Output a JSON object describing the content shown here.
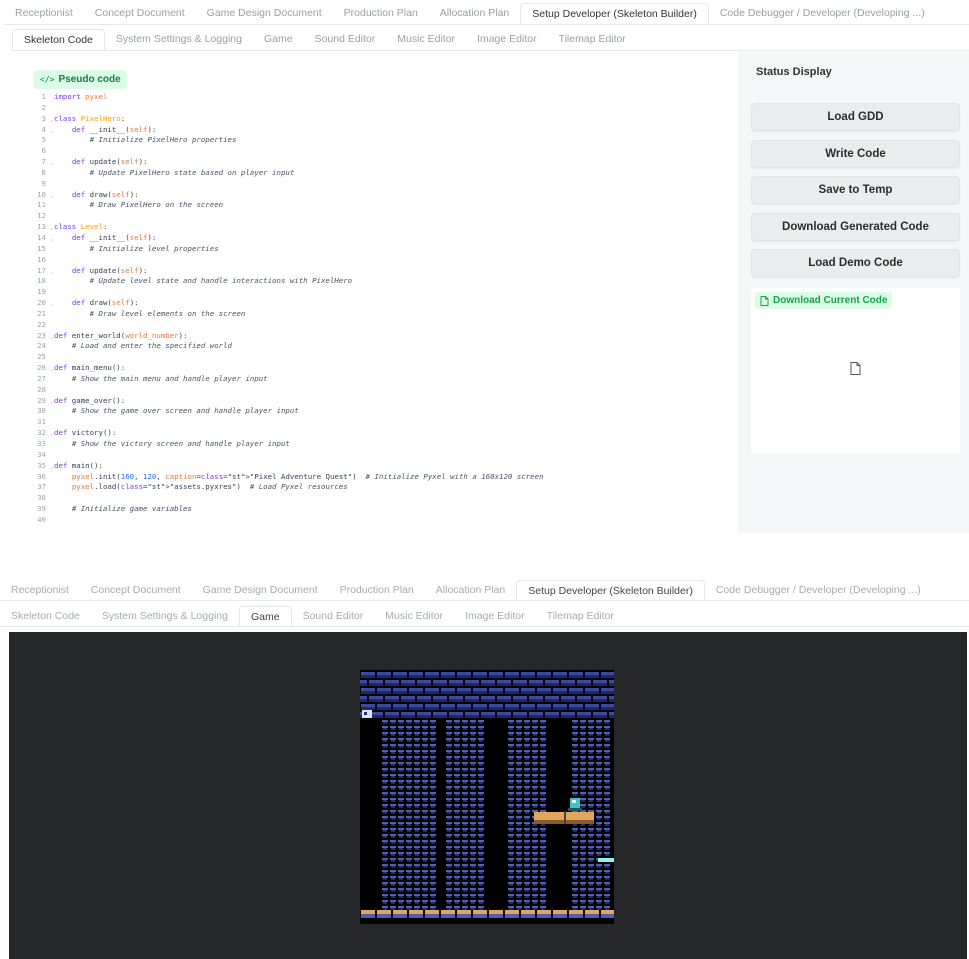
{
  "top_tabs": [
    "Receptionist",
    "Concept Document",
    "Game Design Document",
    "Production Plan",
    "Allocation Plan",
    "Setup Developer (Skeleton Builder)",
    "Code Debugger / Developer (Developing ...)"
  ],
  "top_tabs_active": 5,
  "sub_tabs": [
    "Skeleton Code",
    "System Settings & Logging",
    "Game",
    "Sound Editor",
    "Music Editor",
    "Image Editor",
    "Tilemap Editor"
  ],
  "screen1_sub_active": 0,
  "screen2_sub_active": 2,
  "code": {
    "chip_label": "Pseudo code",
    "chip_icon": "code-icon",
    "lines": [
      {
        "n": "1",
        "t": "import pyxel"
      },
      {
        "n": "2",
        "t": ""
      },
      {
        "n": "3",
        "t": "class PixelHero:",
        "fold": true
      },
      {
        "n": "4",
        "t": "    def __init__(self):",
        "fold": true
      },
      {
        "n": "5",
        "t": "        # Initialize PixelHero properties"
      },
      {
        "n": "6",
        "t": ""
      },
      {
        "n": "7",
        "t": "    def update(self):",
        "fold": true
      },
      {
        "n": "8",
        "t": "        # Update PixelHero state based on player input"
      },
      {
        "n": "9",
        "t": ""
      },
      {
        "n": "10",
        "t": "    def draw(self):",
        "fold": true
      },
      {
        "n": "11",
        "t": "        # Draw PixelHero on the screen"
      },
      {
        "n": "12",
        "t": ""
      },
      {
        "n": "13",
        "t": "class Level:",
        "fold": true
      },
      {
        "n": "14",
        "t": "    def __init__(self):",
        "fold": true
      },
      {
        "n": "15",
        "t": "        # Initialize level properties"
      },
      {
        "n": "16",
        "t": ""
      },
      {
        "n": "17",
        "t": "    def update(self):",
        "fold": true
      },
      {
        "n": "18",
        "t": "        # Update level state and handle interactions with PixelHero"
      },
      {
        "n": "19",
        "t": ""
      },
      {
        "n": "20",
        "t": "    def draw(self):",
        "fold": true
      },
      {
        "n": "21",
        "t": "        # Draw level elements on the screen"
      },
      {
        "n": "22",
        "t": ""
      },
      {
        "n": "23",
        "t": "def enter_world(world_number):",
        "fold": true
      },
      {
        "n": "24",
        "t": "    # Load and enter the specified world"
      },
      {
        "n": "25",
        "t": ""
      },
      {
        "n": "26",
        "t": "def main_menu():",
        "fold": true
      },
      {
        "n": "27",
        "t": "    # Show the main menu and handle player input"
      },
      {
        "n": "28",
        "t": ""
      },
      {
        "n": "29",
        "t": "def game_over():",
        "fold": true
      },
      {
        "n": "30",
        "t": "    # Show the game over screen and handle player input"
      },
      {
        "n": "31",
        "t": ""
      },
      {
        "n": "32",
        "t": "def victory():",
        "fold": true
      },
      {
        "n": "33",
        "t": "    # Show the victory screen and handle player input"
      },
      {
        "n": "34",
        "t": ""
      },
      {
        "n": "35",
        "t": "def main():",
        "fold": true
      },
      {
        "n": "36",
        "t": "    pyxel.init(160, 120, caption=\"Pixel Adventure Quest\")  # Initialize Pyxel with a 160x120 screen"
      },
      {
        "n": "37",
        "t": "    pyxel.load(\"assets.pyxres\")  # Load Pyxel resources"
      },
      {
        "n": "38",
        "t": ""
      },
      {
        "n": "39",
        "t": "    # Initialize game variables"
      },
      {
        "n": "40",
        "t": ""
      }
    ]
  },
  "sidebar": {
    "status_label": "Status Display",
    "buttons": [
      "Load GDD",
      "Write Code",
      "Save to Temp",
      "Download Generated Code",
      "Load Demo Code"
    ],
    "download_chip": "Download Current Code",
    "download_chip_icon": "file-icon",
    "placeholder_icon": "file-icon"
  },
  "game": {
    "background": "#262729",
    "screen_background": "#000000"
  },
  "colors": {
    "chip_bg": "#dcfce7",
    "chip_text": "#15803d",
    "keyword": "#7c3aed",
    "class_name": "#f59e0b",
    "string": "#db2777",
    "number": "#2563eb"
  }
}
